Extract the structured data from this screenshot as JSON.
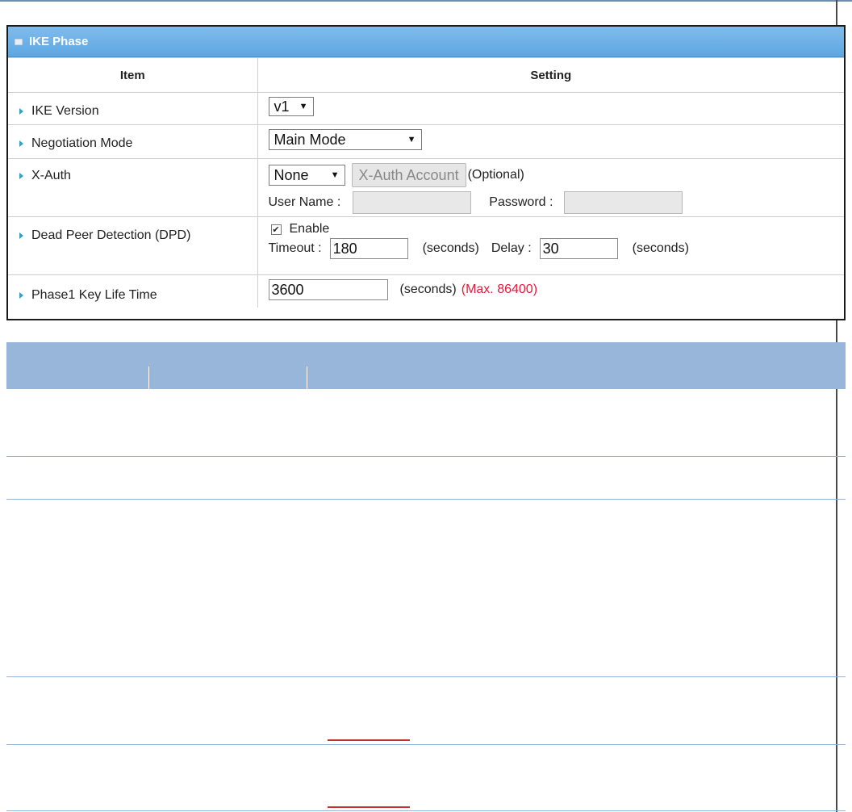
{
  "panel": {
    "title": "IKE Phase",
    "col_item": "Item",
    "col_setting": "Setting"
  },
  "rows": {
    "ike_version": {
      "label": "IKE Version",
      "value": "v1"
    },
    "negotiation_mode": {
      "label": "Negotiation Mode",
      "value": "Main Mode"
    },
    "xauth": {
      "label": "X-Auth",
      "value": "None",
      "button": "X-Auth Account",
      "optional": "(Optional)",
      "user_name_label": "User Name :",
      "password_label": "Password :"
    },
    "dpd": {
      "label": "Dead Peer Detection (DPD)",
      "enable_label": "Enable",
      "enabled": true,
      "timeout_label": "Timeout :",
      "timeout_value": "180",
      "seconds1": "(seconds)",
      "delay_label": "Delay :",
      "delay_value": "30",
      "seconds2": "(seconds)"
    },
    "key_life": {
      "label": "Phase1 Key Life Time",
      "value": "3600",
      "seconds": "(seconds)",
      "max": "(Max. 86400)"
    }
  },
  "colors": {
    "panel_header": "#5ea6e2",
    "bullet": "#35a0c4",
    "warning_text": "#e8183c",
    "desc_header": "#97b6da"
  }
}
